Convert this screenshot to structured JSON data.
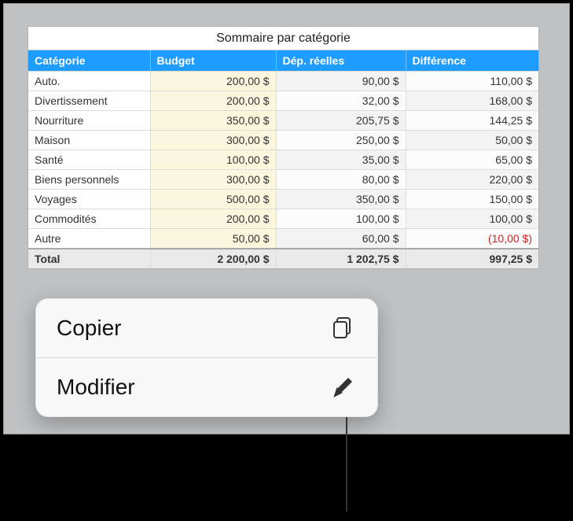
{
  "title": "Sommaire par catégorie",
  "headers": [
    "Catégorie",
    "Budget",
    "Dép. réelles",
    "Différence"
  ],
  "rows": [
    {
      "cat": "Auto.",
      "budget": "200,00 $",
      "actual": "90,00 $",
      "diff": "110,00 $",
      "neg": false
    },
    {
      "cat": "Divertissement",
      "budget": "200,00 $",
      "actual": "32,00 $",
      "diff": "168,00 $",
      "neg": false
    },
    {
      "cat": "Nourriture",
      "budget": "350,00 $",
      "actual": "205,75 $",
      "diff": "144,25 $",
      "neg": false
    },
    {
      "cat": "Maison",
      "budget": "300,00 $",
      "actual": "250,00 $",
      "diff": "50,00 $",
      "neg": false
    },
    {
      "cat": "Santé",
      "budget": "100,00 $",
      "actual": "35,00 $",
      "diff": "65,00 $",
      "neg": false
    },
    {
      "cat": "Biens personnels",
      "budget": "300,00 $",
      "actual": "80,00 $",
      "diff": "220,00 $",
      "neg": false
    },
    {
      "cat": "Voyages",
      "budget": "500,00 $",
      "actual": "350,00 $",
      "diff": "150,00 $",
      "neg": false
    },
    {
      "cat": "Commodités",
      "budget": "200,00 $",
      "actual": "100,00 $",
      "diff": "100,00 $",
      "neg": false
    },
    {
      "cat": "Autre",
      "budget": "50,00 $",
      "actual": "60,00 $",
      "diff": "(10,00 $)",
      "neg": true
    }
  ],
  "total": {
    "cat": "Total",
    "budget": "2 200,00 $",
    "actual": "1 202,75 $",
    "diff": "997,25 $"
  },
  "menu": {
    "copy": "Copier",
    "edit": "Modifier"
  },
  "chart_data": {
    "type": "table",
    "title": "Sommaire par catégorie",
    "columns": [
      "Catégorie",
      "Budget",
      "Dép. réelles",
      "Différence"
    ],
    "rows": [
      [
        "Auto.",
        200.0,
        90.0,
        110.0
      ],
      [
        "Divertissement",
        200.0,
        32.0,
        168.0
      ],
      [
        "Nourriture",
        350.0,
        205.75,
        144.25
      ],
      [
        "Maison",
        300.0,
        250.0,
        50.0
      ],
      [
        "Santé",
        100.0,
        35.0,
        65.0
      ],
      [
        "Biens personnels",
        300.0,
        80.0,
        220.0
      ],
      [
        "Voyages",
        500.0,
        350.0,
        150.0
      ],
      [
        "Commodités",
        200.0,
        100.0,
        100.0
      ],
      [
        "Autre",
        50.0,
        60.0,
        -10.0
      ]
    ],
    "totals": [
      "Total",
      2200.0,
      1202.75,
      997.25
    ],
    "currency": "CAD/EUR-local ($)"
  }
}
